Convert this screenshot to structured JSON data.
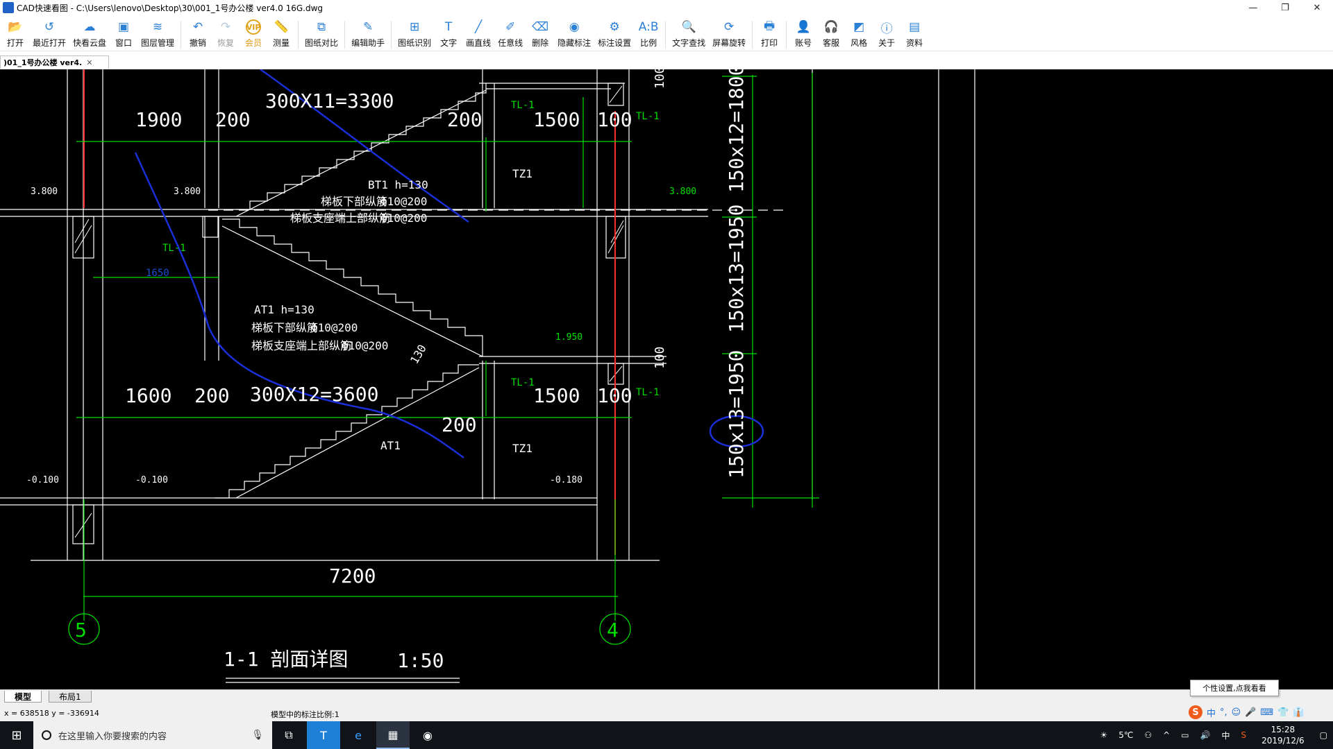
{
  "window": {
    "title": "CAD快速看图 - C:\\Users\\lenovo\\Desktop\\30\\001_1号办公楼 ver4.0 16G.dwg",
    "minimize": "—",
    "maximize": "❐",
    "close": "✕"
  },
  "toolbar": [
    {
      "label": "打开",
      "icon": "open-folder-icon",
      "glyph": "📂"
    },
    {
      "label": "最近打开",
      "icon": "recent-icon",
      "glyph": "↺"
    },
    {
      "label": "快看云盘",
      "icon": "cloud-icon",
      "glyph": "☁"
    },
    {
      "label": "窗口",
      "icon": "window-icon",
      "glyph": "▣"
    },
    {
      "label": "图层管理",
      "icon": "layers-icon",
      "glyph": "≋"
    },
    {
      "label": "撤销",
      "icon": "undo-icon",
      "glyph": "↶"
    },
    {
      "label": "恢复",
      "icon": "redo-icon",
      "glyph": "↷"
    },
    {
      "label": "会员",
      "icon": "vip-icon",
      "glyph": "VIP"
    },
    {
      "label": "测量",
      "icon": "measure-icon",
      "glyph": "📏"
    },
    {
      "label": "图纸对比",
      "icon": "compare-icon",
      "glyph": "⧉"
    },
    {
      "label": "编辑助手",
      "icon": "edit-assistant-icon",
      "glyph": "✎"
    },
    {
      "label": "图纸识别",
      "icon": "recognize-icon",
      "glyph": "⊞"
    },
    {
      "label": "文字",
      "icon": "text-icon",
      "glyph": "T"
    },
    {
      "label": "画直线",
      "icon": "line-icon",
      "glyph": "╱"
    },
    {
      "label": "任意线",
      "icon": "freehand-icon",
      "glyph": "✐"
    },
    {
      "label": "删除",
      "icon": "eraser-icon",
      "glyph": "⌫"
    },
    {
      "label": "隐藏标注",
      "icon": "hide-eye-icon",
      "glyph": "◉"
    },
    {
      "label": "标注设置",
      "icon": "annotation-settings-icon",
      "glyph": "⚙"
    },
    {
      "label": "比例",
      "icon": "scale-icon",
      "glyph": "A:B"
    },
    {
      "label": "文字查找",
      "icon": "text-search-icon",
      "glyph": "🔍"
    },
    {
      "label": "屏幕旋转",
      "icon": "rotate-screen-icon",
      "glyph": "⟳"
    },
    {
      "label": "打印",
      "icon": "print-icon",
      "glyph": "🖶"
    },
    {
      "label": "账号",
      "icon": "account-icon",
      "glyph": "👤"
    },
    {
      "label": "客服",
      "icon": "headset-icon",
      "glyph": "🎧"
    },
    {
      "label": "风格",
      "icon": "style-icon",
      "glyph": "◩"
    },
    {
      "label": "关于",
      "icon": "info-icon",
      "glyph": "ⓘ"
    },
    {
      "label": "资料",
      "icon": "docs-icon",
      "glyph": "▤"
    }
  ],
  "doc_tab": {
    "label": ")01_1号办公楼 ver4.",
    "close": "✕"
  },
  "drawing": {
    "upper_dims": [
      "1900",
      "200",
      "300X11=3300",
      "200",
      "1500",
      "100"
    ],
    "lower_dims": [
      "1600",
      "200",
      "300X12=3600",
      "200",
      "1500",
      "100"
    ],
    "levels": [
      "3.800",
      "3.800",
      "3.800",
      "1.950",
      "-0.100",
      "-0.100",
      "-0.100"
    ],
    "levels_right": "-0.180",
    "beam_labels": [
      "TL-1",
      "TL-1",
      "TL-1",
      "TL-1",
      "TL-1"
    ],
    "column_labels": [
      "TZ1",
      "TZ1"
    ],
    "bt1": {
      "title": "BT1  h=130",
      "line1": "梯板下部纵筋",
      "val1": "Φ10@200",
      "line2": "梯板支座端上部纵筋",
      "val2": "Φ10@200"
    },
    "at1": {
      "title": "AT1  h=130",
      "line1": "梯板下部纵筋",
      "val1": "Φ10@200",
      "line2": "梯板支座端上部纵筋",
      "val2": "Φ10@200"
    },
    "at1_label": "AT1",
    "dim_1650": "1650",
    "dim_130": "130",
    "dim_100_a": "100",
    "dim_100_b": "100",
    "vertical_dims": [
      "150x12=1800",
      "150x13=1950",
      "150x13=1950"
    ],
    "span": "7200",
    "axis_left": "5",
    "axis_right": "4",
    "section_title": "1-1  剖面详图",
    "section_scale": "1:50",
    "dim_300": "300"
  },
  "layout_tabs": [
    "模型",
    "布局1"
  ],
  "status": {
    "coords": "x = 638518  y = -336914",
    "scale_text": "模型中的标注比例:1",
    "tooltip": "个性设置,点我看看"
  },
  "ime": [
    "S",
    "中",
    "°,",
    "☺",
    "🎤",
    "⌨",
    "👕",
    "👔"
  ],
  "taskbar": {
    "search_placeholder": "在这里输入你要搜索的内容",
    "weather": "5℃",
    "ime_lang": "中",
    "time": "15:28",
    "date": "2019/12/6"
  },
  "colors": {
    "canvas": "#000000",
    "white_lines": "#ffffff",
    "green_dims": "#00ff00",
    "red_axis": "#ff0000",
    "blue_markup": "#1a2fd6"
  }
}
